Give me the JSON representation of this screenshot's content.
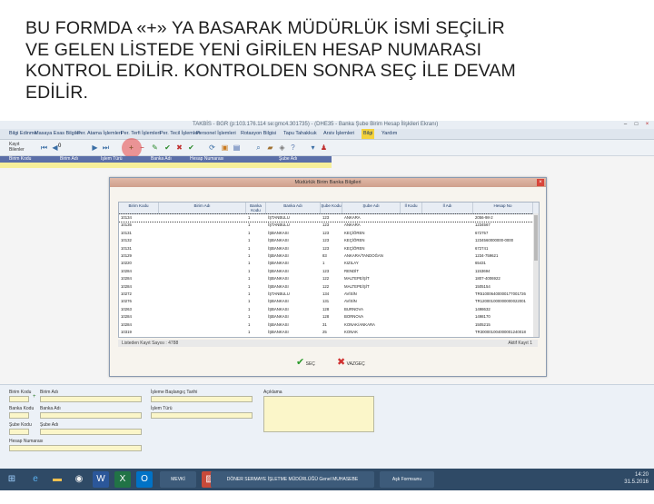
{
  "caption": {
    "lines": [
      "BU FORMDA «+» YA BASARAK MÜDÜRLÜK İSMİ SEÇİLİR",
      "VE GELEN LİSTEDE YENİ GİRİLEN HESAP NUMARASI",
      "KONTROL EDİLİR. KONTROLDEN SONRA SEÇ İLE DEVAM",
      "EDİLİR."
    ]
  },
  "app": {
    "title": "TAKBİS - BGR (p:103.176.114 se:gmc4.301735) - (DHE35 - Banka Şube Birim Hesap İlişkileri Ekranı)",
    "menu": [
      "Bilgi Edinme",
      "Masaya Esas Bilgiler",
      "Per. Atama İşlemleri",
      "Per. Terfi İşlemleri",
      "Per. Tecil İşlemleri",
      "Personel İşlemleri",
      "Rotasyon Bilgisi",
      "Tapu Tahakkuk",
      "Arsiv İşlemleri",
      "Bilgi",
      "Yardım"
    ],
    "menu_highlight_index": 9,
    "toolbar": {
      "record_label": "Kayıt Bilenler",
      "record_count": "0"
    },
    "grid_headers": [
      "Birim Kodu",
      "Birim Adı",
      "İşlem Türü",
      "Banka Adı",
      "Hesap Numarası",
      "Şube Adı"
    ]
  },
  "dialog": {
    "title": "Müdürlük Birim Banka Bilgileri",
    "columns": [
      "Birim Kodu",
      "Birim Adı",
      "Banka Kodu",
      "Banka Adı",
      "Şube Kodu",
      "Şube Adı",
      "İl Kodu",
      "İl Adı",
      "Hesap No"
    ],
    "rows": [
      {
        "birim_kodu": "10134",
        "banka_kodu": "1",
        "banka_adi": "İŞTANBULU",
        "sube_kodu": "123",
        "sube_adi": "ANKARA",
        "hesap_no": "2056-98-2"
      },
      {
        "birim_kodu": "10135",
        "banka_kodu": "1",
        "banka_adi": "İŞTANBULU",
        "sube_kodu": "123",
        "sube_adi": "ANKARA",
        "hesap_no": "1234567"
      },
      {
        "birim_kodu": "10131",
        "banka_kodu": "1",
        "banka_adi": "İŞBANKASI",
        "sube_kodu": "123",
        "sube_adi": "KEÇİÖREN",
        "hesap_no": "672757"
      },
      {
        "birim_kodu": "10132",
        "banka_kodu": "1",
        "banka_adi": "İŞBANKASI",
        "sube_kodu": "123",
        "sube_adi": "KEÇİÖREN",
        "hesap_no": "1234560000000-0000"
      },
      {
        "birim_kodu": "10131",
        "banka_kodu": "1",
        "banka_adi": "İŞBANKASI",
        "sube_kodu": "123",
        "sube_adi": "KEÇİÖREN",
        "hesap_no": "672741"
      },
      {
        "birim_kodu": "10129",
        "banka_kodu": "1",
        "banka_adi": "İŞBANKASI",
        "sube_kodu": "83",
        "sube_adi": "ANKARA/TANDOĞAN",
        "hesap_no": "1234-759621"
      },
      {
        "birim_kodu": "10220",
        "banka_kodu": "1",
        "banka_adi": "İŞBANKASI",
        "sube_kodu": "1",
        "sube_adi": "KIZILAY",
        "hesap_no": "65431"
      },
      {
        "birim_kodu": "10284",
        "banka_kodu": "1",
        "banka_adi": "İŞBANKASI",
        "sube_kodu": "123",
        "sube_adi": "RENDİT",
        "hesap_no": "1153694"
      },
      {
        "birim_kodu": "10284",
        "banka_kodu": "1",
        "banka_adi": "İŞBANKASI",
        "sube_kodu": "122",
        "sube_adi": "MALTEPE/ŞİT",
        "hesap_no": "1807-4006922"
      },
      {
        "birim_kodu": "10284",
        "banka_kodu": "1",
        "banka_adi": "İŞBANKASI",
        "sube_kodu": "122",
        "sube_adi": "MALTEPE/ŞİT",
        "hesap_no": "1505154"
      },
      {
        "birim_kodu": "10272",
        "banka_kodu": "1",
        "banka_adi": "İŞTANBULU",
        "sube_kodu": "134",
        "sube_adi": "AVİSİN",
        "hesap_no": "TR510006400000177001726"
      },
      {
        "birim_kodu": "10276",
        "banka_kodu": "1",
        "banka_adi": "İŞBANKASI",
        "sube_kodu": "131",
        "sube_adi": "AVİSİN",
        "hesap_no": "TR120001000000000022001"
      },
      {
        "birim_kodu": "10263",
        "banka_kodu": "1",
        "banka_adi": "İŞBANKASI",
        "sube_kodu": "128",
        "sube_adi": "BURNOVA",
        "hesap_no": "1498632"
      },
      {
        "birim_kodu": "10284",
        "banka_kodu": "1",
        "banka_adi": "İŞBANKASI",
        "sube_kodu": "128",
        "sube_adi": "BORNOVA",
        "hesap_no": "1498170"
      },
      {
        "birim_kodu": "10284",
        "banka_kodu": "1",
        "banka_adi": "İŞBANKASI",
        "sube_kodu": "31",
        "sube_adi": "KONAK/ANKARA",
        "hesap_no": "1505215"
      },
      {
        "birim_kodu": "10319",
        "banka_kodu": "1",
        "banka_adi": "İŞBANKASI",
        "sube_kodu": "25",
        "sube_adi": "KONAK",
        "hesap_no": "TR300001004000001240018"
      }
    ],
    "status_left": "Listeden Kayıt Sayısı : 4788",
    "status_right": "Aktif Kayıt 1",
    "select_label": "SEÇ",
    "cancel_label": "VAZGEÇ"
  },
  "form": {
    "labels": {
      "birim_kodu": "Birim Kodu",
      "birim_adi": "Birim Adı",
      "islem_baslangic": "İşleme Başlangıç Tarihi",
      "aciklama": "Açıklama",
      "banka_kodu": "Banka Kodu",
      "banka_adi": "Banka Adı",
      "islem_turu": "İşlem Türü",
      "sube_kodu": "Şube Kodu",
      "sube_adi": "Şube Adı",
      "hesap_numarasi": "Hesap Numarası"
    }
  },
  "taskbar": {
    "apps": [
      "windows-start",
      "ie",
      "explorer",
      "chrome",
      "word",
      "excel",
      "outlook",
      "takbis",
      "paint",
      "powerpoint"
    ],
    "open_windows": [
      "MEVKİ PLATFORMU",
      "DÖNER SERMAYE İŞLETME MÜDÜRLÜĞÜ Genel MUHASEBE",
      "Aşk Formsunu"
    ],
    "time": "14:20",
    "date": "31.5.2016"
  }
}
